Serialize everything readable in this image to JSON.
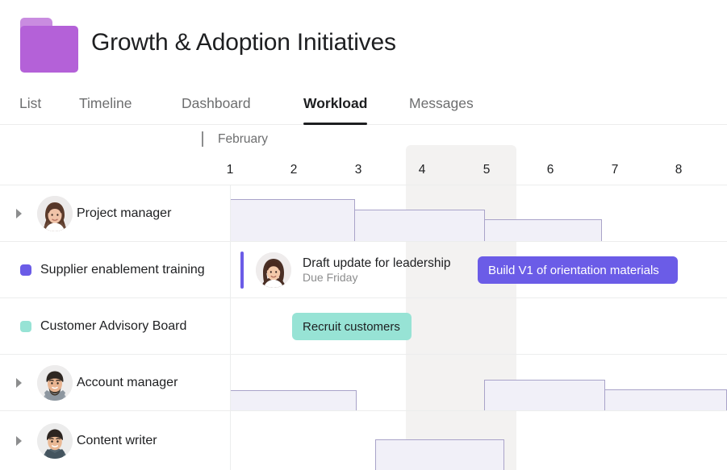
{
  "header": {
    "project_title": "Growth & Adoption Initiatives",
    "folder_icon": "folder-icon",
    "folder_color": "#b461d8",
    "folder_tab_color": "#c98ce0"
  },
  "tabs": [
    {
      "label": "List",
      "active": false
    },
    {
      "label": "Timeline",
      "active": false
    },
    {
      "label": "Dashboard",
      "active": false
    },
    {
      "label": "Workload",
      "active": true
    },
    {
      "label": "Messages",
      "active": false
    }
  ],
  "timeline": {
    "month": "February",
    "days": [
      "1",
      "2",
      "3",
      "4",
      "5",
      "6",
      "7",
      "8"
    ],
    "weekend_days": [
      "4",
      "5"
    ],
    "weekend_shade_color": "#f3f2f1"
  },
  "rows": [
    {
      "name": "Project manager",
      "type": "person",
      "avatar": "avatar-woman-brown-hair",
      "caret": "expand-triangle-icon"
    },
    {
      "name": "Supplier enablement training",
      "type": "task",
      "swatch_color": "#6b5ce7"
    },
    {
      "name": "Customer Advisory Board",
      "type": "task",
      "swatch_color": "#97e3d5"
    },
    {
      "name": "Account manager",
      "type": "person",
      "avatar": "avatar-man-beard",
      "caret": "expand-triangle-icon"
    },
    {
      "name": "Content writer",
      "type": "person",
      "avatar": "avatar-man-short-hair",
      "caret": "expand-triangle-icon"
    }
  ],
  "bars": {
    "build_v1": {
      "label": "Build V1 of orientation materials",
      "color": "#6b5ce7"
    },
    "recruit": {
      "label": "Recruit customers",
      "color": "#97e3d5"
    }
  },
  "task_card": {
    "title": "Draft update for leadership",
    "subtitle": "Due Friday",
    "accent_color": "#6b5ce7",
    "avatar": "avatar-woman-dark-hair"
  }
}
